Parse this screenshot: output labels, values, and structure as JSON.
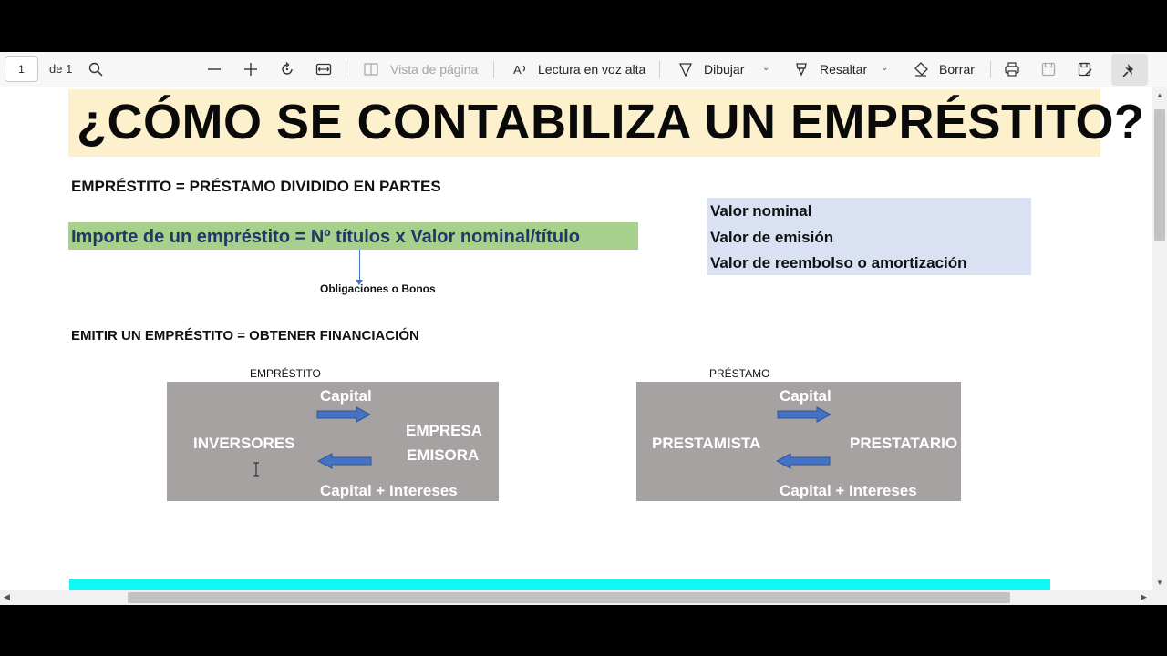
{
  "toolbar": {
    "page_number": "1",
    "page_of": "de 1",
    "page_view_label": "Vista de página",
    "read_aloud_label": "Lectura en voz alta",
    "draw_label": "Dibujar",
    "highlight_label": "Resaltar",
    "erase_label": "Borrar",
    "icons": [
      "search-icon",
      "zoom-out-icon",
      "zoom-in-icon",
      "rotate-icon",
      "fit-page-icon",
      "page-view-icon",
      "read-aloud-icon",
      "draw-icon",
      "highlight-icon",
      "eraser-icon",
      "print-icon",
      "save-icon",
      "save-as-icon",
      "pin-icon"
    ]
  },
  "document": {
    "title": "¿CÓMO SE CONTABILIZA UN EMPRÉSTITO?",
    "definition": "EMPRÉSTITO = PRÉSTAMO DIVIDIDO EN PARTES",
    "formula": "Importe de un empréstito = Nº títulos x Valor nominal/título",
    "formula_note": "Obligaciones o Bonos",
    "values": [
      "Valor nominal",
      "Valor de emisión",
      "Valor de reembolso o amortización"
    ],
    "emitir": "EMITIR UN EMPRÉSTITO = OBTENER FINANCIACIÓN",
    "diagram_left": {
      "caption": "EMPRÉSTITO",
      "left_party": "INVERSORES",
      "right_party_line1": "EMPRESA",
      "right_party_line2": "EMISORA",
      "top_flow": "Capital",
      "bottom_flow": "Capital + Intereses"
    },
    "diagram_right": {
      "caption": "PRÉSTAMO",
      "left_party": "PRESTAMISTA",
      "right_party": "PRESTATARIO",
      "top_flow": "Capital",
      "bottom_flow": "Capital + Intereses"
    }
  },
  "colors": {
    "title_band": "#fdf0cd",
    "formula_band": "#a8d08d",
    "values_box": "#d9e1f2",
    "diagram_box": "#a6a2a2",
    "arrow_blue": "#4472c4",
    "cyan_band": "#0ff8f6"
  }
}
